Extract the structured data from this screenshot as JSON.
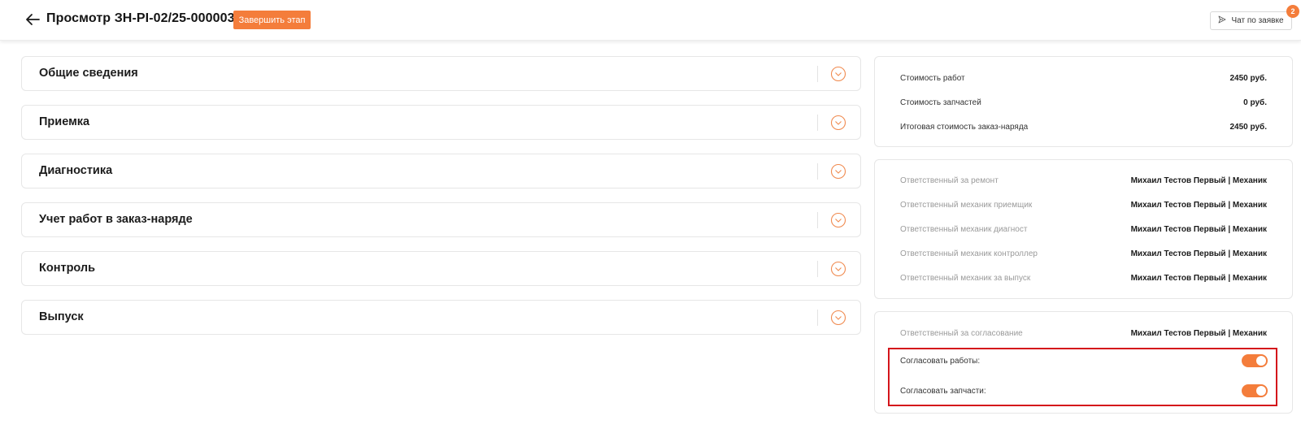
{
  "header": {
    "title": "Просмотр ЗН-PI-02/25-000003",
    "finish_stage_label": "Завершить этап",
    "chat_label": "Чат по заявке",
    "chat_badge": "2"
  },
  "sections": [
    {
      "title": "Общие сведения"
    },
    {
      "title": "Приемка"
    },
    {
      "title": "Диагностика"
    },
    {
      "title": "Учет работ в заказ-наряде"
    },
    {
      "title": "Контроль"
    },
    {
      "title": "Выпуск"
    }
  ],
  "costs": [
    {
      "label": "Стоимость работ",
      "value": "2450 руб."
    },
    {
      "label": "Стоимость запчастей",
      "value": "0 руб."
    },
    {
      "label": "Итоговая стоимость заказ-наряда",
      "value": "2450 руб."
    }
  ],
  "responsibles": [
    {
      "label": "Ответственный за ремонт",
      "value": "Михаил Тестов Первый | Механик"
    },
    {
      "label": "Ответственный механик приемщик",
      "value": "Михаил Тестов Первый | Механик"
    },
    {
      "label": "Ответственный механик диагност",
      "value": "Михаил Тестов Первый | Механик"
    },
    {
      "label": "Ответственный механик контроллер",
      "value": "Михаил Тестов Первый | Механик"
    },
    {
      "label": "Ответственный механик за выпуск",
      "value": "Михаил Тестов Первый | Механик"
    }
  ],
  "approval": {
    "responsible_label": "Ответственный за согласование",
    "responsible_value": "Михаил Тестов Первый | Механик",
    "approve_works_label": "Согласовать работы:",
    "approve_works_on": true,
    "approve_parts_label": "Согласовать запчасти:",
    "approve_parts_on": true
  },
  "colors": {
    "accent": "#f47d3b",
    "highlight": "#d4151b"
  },
  "icons": {
    "back": "arrow-left-icon",
    "chat": "send-icon",
    "expand": "chevron-down-circle-icon"
  }
}
